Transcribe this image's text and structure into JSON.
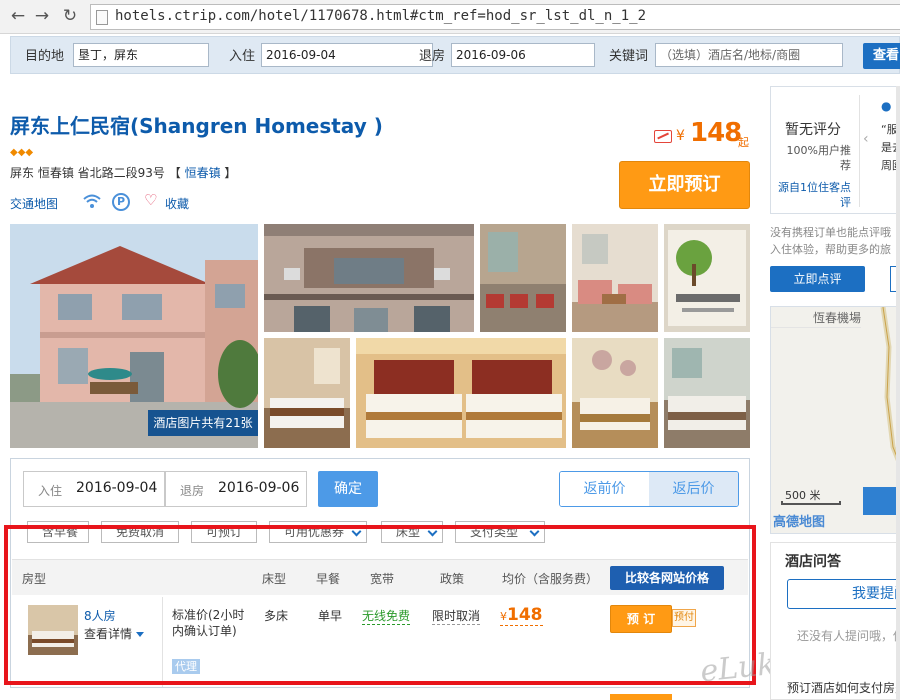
{
  "browser": {
    "url": "hotels.ctrip.com/hotel/1170678.html#ctm_ref=hod_sr_lst_dl_n_1_2",
    "back_icon": "arrow-left",
    "forward_icon": "arrow-right",
    "reload_icon": "reload"
  },
  "search": {
    "destination_label": "目的地",
    "destination_value": "垦丁，屏东",
    "checkin_label": "入住",
    "checkin_value": "2016-09-04",
    "checkout_label": "退房",
    "checkout_value": "2016-09-06",
    "keyword_label": "关键词",
    "keyword_placeholder": "（选填）酒店名/地标/商圈",
    "search_button": "查看"
  },
  "hotel": {
    "name": "屏东上仁民宿(Shangren Homestay )",
    "diamonds": "◆◆◆",
    "address": "屏东 恒春镇 省北路二段93号",
    "district_open": "【",
    "district": "恒春镇",
    "district_close": "】",
    "map_link": "交通地图",
    "favorite_label": "收藏",
    "parking_glyph": "P",
    "price_currency": "¥",
    "price_value": "148",
    "price_suffix": "起",
    "book_now": "立即预订",
    "photo_count": "酒店图片共有21张"
  },
  "booking": {
    "checkin_label": "入住",
    "checkin_value": "2016-09-04",
    "checkout_label": "退房",
    "checkout_value": "2016-09-06",
    "confirm": "确定",
    "price_before": "返前价",
    "price_after": "返后价",
    "filters": [
      "含早餐",
      "免费取消",
      "可预订",
      "可用优惠券",
      "床型",
      "支付类型"
    ],
    "columns": {
      "room_type": "房型",
      "bed": "床型",
      "breakfast": "早餐",
      "broadband": "宽带",
      "policy": "政策",
      "avg_price": "均价（含服务费）",
      "compare": "比较各网站价格"
    },
    "room": {
      "name": "8人房",
      "detail": "查看详情",
      "rate_name": "标准价(2小时内确认订单)",
      "agent": "代理",
      "bed": "多床",
      "breakfast": "单早",
      "broadband": "无线免费",
      "policy": "限时取消",
      "price_currency": "¥",
      "price": "148",
      "book": "预 订",
      "prepay": "预付"
    }
  },
  "sidebar": {
    "no_rating": "暂无评分",
    "recommend": "100%用户推荐",
    "from_guest": "源自1位住客点评",
    "quote_line1": "“服",
    "quote_line2": "是去",
    "quote_line3": "周圍",
    "review_hint_line1": "没有携程订单也能点评哦",
    "review_hint_line2": "入住体验，帮助更多的旅",
    "write_review": "立即点评",
    "map_airport": "恆春機場",
    "map_scale": "500 米",
    "map_logo": "高德地图",
    "qa_title": "酒店问答",
    "ask_button": "我要提问",
    "no_questions": "还没有人提问哦，你",
    "pay_question": "预订酒店如何支付房费"
  },
  "watermark": "eLuking.net",
  "colors": {
    "brand_blue": "#0d5bab",
    "button_orange": "#ff9a14",
    "price_orange": "#f06e00",
    "highlight_red": "#e8151b"
  }
}
